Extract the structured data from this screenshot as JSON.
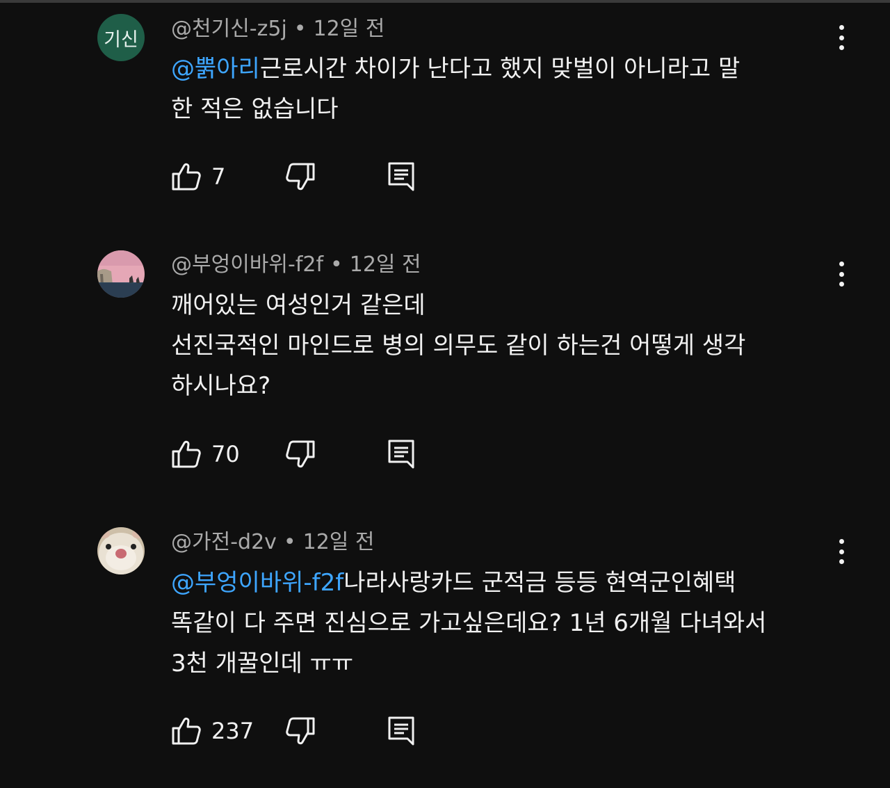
{
  "comments": [
    {
      "avatar_text": "기신",
      "author": "@천기신-z5j",
      "time": "12일 전",
      "mention": "@뿕아리",
      "lines": [
        "근로시간 차이가 난다고 했지 맞벌이 아니라고 말",
        "한 적은 없습니다"
      ],
      "likes": "7"
    },
    {
      "avatar_image": "pink-sky-sea-landscape",
      "author": "@부엉이바위-f2f",
      "time": "12일 전",
      "mention": "",
      "lines": [
        "깨어있는 여성인거 같은데",
        "선진국적인 마인드로 병의 의무도 같이 하는건 어떻게 생각",
        "하시나요?"
      ],
      "likes": "70"
    },
    {
      "avatar_image": "hamster-face",
      "author": "@가전-d2v",
      "time": "12일 전",
      "mention": "@부엉이바위-f2f",
      "lines": [
        "나라사랑카드 군적금 등등 현역군인혜택",
        "똑같이 다 주면 진심으로 가고싶은데요? 1년 6개월 다녀와서",
        "3천 개꿀인데 ㅠㅠ"
      ],
      "likes": "237"
    }
  ],
  "separator": "•",
  "icons": {
    "like": "thumbs-up-icon",
    "dislike": "thumbs-down-icon",
    "reply": "reply-icon",
    "more": "more-vertical-icon"
  },
  "colors": {
    "background": "#0f0f0f",
    "text": "#f1f1f1",
    "meta": "#aaaaaa",
    "mention": "#3ea6ff",
    "avatar_green": "#1f5e48"
  }
}
